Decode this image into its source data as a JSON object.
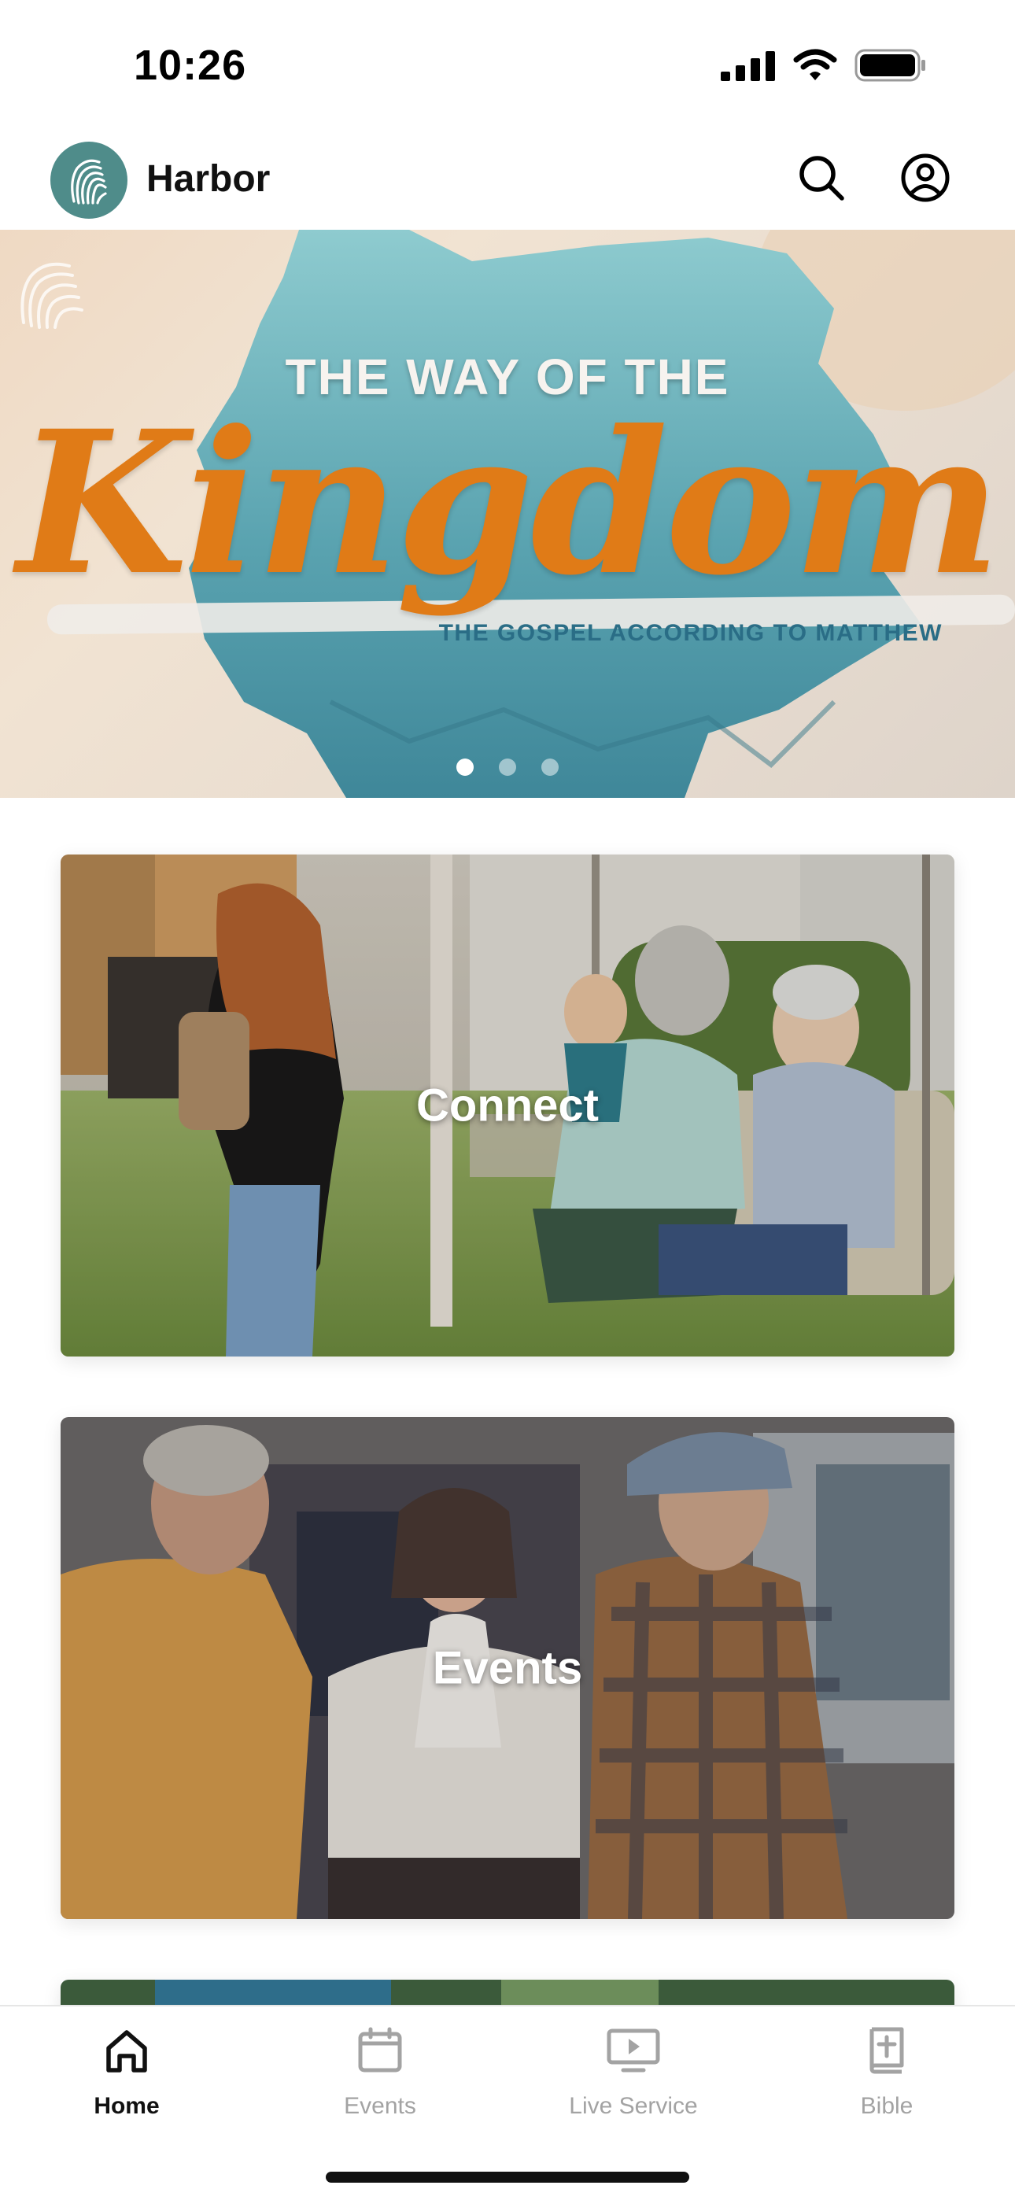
{
  "status_bar": {
    "time": "10:26",
    "icons": [
      "cellular-signal-icon",
      "wifi-icon",
      "battery-icon"
    ]
  },
  "header": {
    "logo_icon": "harbor-logo-icon",
    "title": "Harbor",
    "actions": [
      {
        "name": "search",
        "icon": "search-icon"
      },
      {
        "name": "account",
        "icon": "user-circle-icon"
      }
    ]
  },
  "hero": {
    "kicker": "THE WAY OF THE",
    "script_title": "Kingdom",
    "subtitle": "THE GOSPEL ACCORDING TO MATTHEW",
    "carousel": {
      "count": 3,
      "active_index": 0
    }
  },
  "cards": {
    "connect": {
      "label": "Connect"
    },
    "events": {
      "label": "Events"
    }
  },
  "tab_bar": {
    "tabs": [
      {
        "label": "Home",
        "icon": "home-icon",
        "active": true
      },
      {
        "label": "Events",
        "icon": "calendar-icon",
        "active": false
      },
      {
        "label": "Live Service",
        "icon": "play-screen-icon",
        "active": false
      },
      {
        "label": "Bible",
        "icon": "bible-icon",
        "active": false
      }
    ]
  },
  "colors": {
    "brand_teal": "#4f8c8a",
    "hero_orange": "#e07b17",
    "hero_blue": "#2a6d86",
    "tab_inactive": "#a3a3a3"
  }
}
